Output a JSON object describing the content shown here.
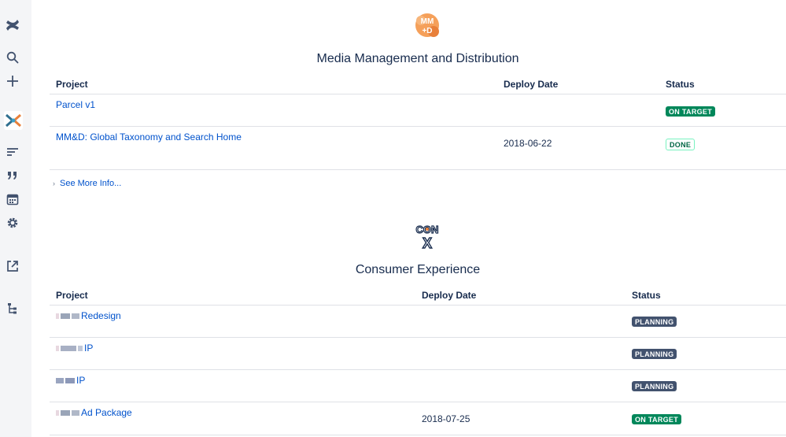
{
  "sidebar": {
    "icons": [
      "confluence-logo-icon",
      "search-icon",
      "create-plus-icon",
      "space-avatar-icon",
      "page-tree-icon",
      "quote-icon",
      "calendar-icon",
      "settings-icon",
      "external-link-icon",
      "hierarchy-icon"
    ]
  },
  "mmd": {
    "title": "Media Management and Distribution",
    "logo_text": "MM+D",
    "headers": {
      "project": "Project",
      "deploy": "Deploy Date",
      "status": "Status"
    },
    "rows": [
      {
        "project": "Parcel v1",
        "deploy": "",
        "status": "ON TARGET",
        "status_kind": "green"
      },
      {
        "project": "MM&D: Global Taxonomy and Search Home",
        "deploy": "2018-06-22",
        "status": "DONE",
        "status_kind": "done"
      }
    ],
    "expand_label": "See More Info..."
  },
  "conx": {
    "title": "Consumer Experience",
    "logo_text": "CON X",
    "headers": {
      "project": "Project",
      "deploy": "Deploy Date",
      "status": "Status"
    },
    "rows": [
      {
        "project": "Redesign",
        "deploy": "",
        "status": "PLANNING",
        "status_kind": "planning"
      },
      {
        "project": "IP",
        "deploy": "",
        "status": "PLANNING",
        "status_kind": "planning"
      },
      {
        "project": "IP",
        "deploy": "",
        "status": "PLANNING",
        "status_kind": "planning"
      },
      {
        "project": "Ad Package",
        "deploy": "2018-07-25",
        "status": "ON TARGET",
        "status_kind": "green"
      }
    ]
  },
  "colors": {
    "link": "#0052cc",
    "on_target": "#00875a",
    "planning": "#42526e",
    "sidebar_bg": "#f4f5f7"
  }
}
